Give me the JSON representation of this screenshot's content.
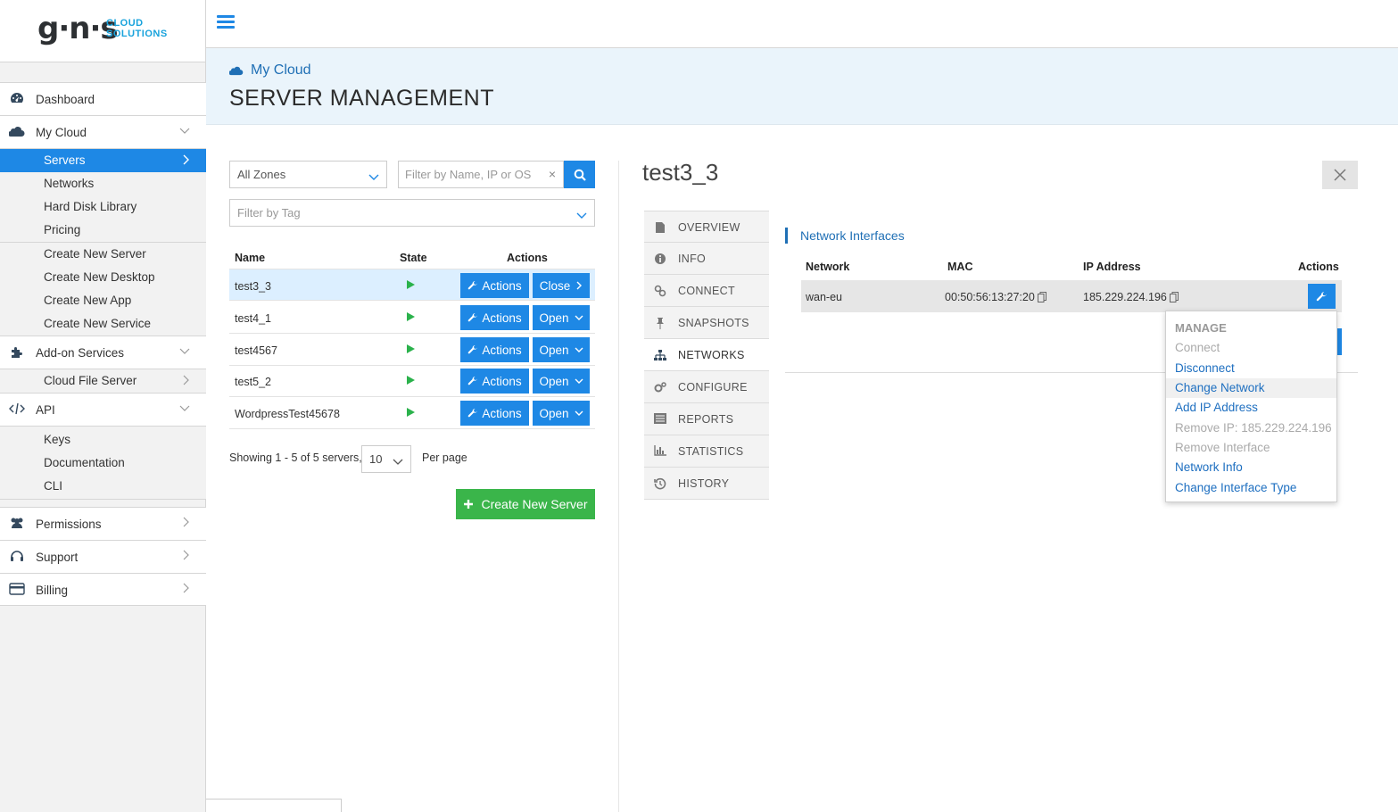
{
  "logo": {
    "main": "g·n·s",
    "sub_line1": "CLOUD",
    "sub_line2": "SOLUTIONS"
  },
  "sidebar": {
    "dashboard": "Dashboard",
    "my_cloud": "My Cloud",
    "my_cloud_items": [
      "Servers",
      "Networks",
      "Hard Disk Library",
      "Pricing"
    ],
    "create_items": [
      "Create New Server",
      "Create New Desktop",
      "Create New App",
      "Create New Service"
    ],
    "addon": "Add-on Services",
    "addon_items": [
      "Cloud File Server"
    ],
    "api": "API",
    "api_items": [
      "Keys",
      "Documentation",
      "CLI"
    ],
    "permissions": "Permissions",
    "support": "Support",
    "billing": "Billing"
  },
  "header": {
    "breadcrumb": "My Cloud",
    "title": "SERVER MANAGEMENT"
  },
  "filters": {
    "zone_selected": "All Zones",
    "search_placeholder": "Filter by Name, IP or OS",
    "clear": "×",
    "tag_placeholder": "Filter by Tag"
  },
  "table": {
    "headers": {
      "name": "Name",
      "state": "State",
      "actions": "Actions"
    },
    "rows": [
      {
        "name": "test3_3",
        "action": "Actions",
        "toggle": "Close"
      },
      {
        "name": "test4_1",
        "action": "Actions",
        "toggle": "Open"
      },
      {
        "name": "test4567",
        "action": "Actions",
        "toggle": "Open"
      },
      {
        "name": "test5_2",
        "action": "Actions",
        "toggle": "Open"
      },
      {
        "name": "WordpressTest45678",
        "action": "Actions",
        "toggle": "Open"
      }
    ],
    "showing": "Showing 1 - 5 of 5 servers,",
    "per_page_value": "10",
    "per_page_label": "Per page",
    "create_button": "Create New Server"
  },
  "detail": {
    "server_name": "test3_3",
    "tabs": [
      "OVERVIEW",
      "INFO",
      "CONNECT",
      "SNAPSHOTS",
      "NETWORKS",
      "CONFIGURE",
      "REPORTS",
      "STATISTICS",
      "HISTORY"
    ],
    "active_tab": "NETWORKS",
    "section_title": "Network Interfaces",
    "columns": {
      "network": "Network",
      "mac": "MAC",
      "ip": "IP Address",
      "actions": "Actions"
    },
    "interface": {
      "network": "wan-eu",
      "mac": "00:50:56:13:27:20",
      "ip": "185.229.224.196"
    }
  },
  "dropdown": {
    "header": "MANAGE",
    "items": [
      {
        "label": "Connect",
        "enabled": false
      },
      {
        "label": "Disconnect",
        "enabled": true
      },
      {
        "label": "Change Network",
        "enabled": true
      },
      {
        "label": "Add IP Address",
        "enabled": true
      },
      {
        "label": "Remove IP: 185.229.224.196",
        "enabled": false
      },
      {
        "label": "Remove Interface",
        "enabled": false
      },
      {
        "label": "Network Info",
        "enabled": true
      },
      {
        "label": "Change Interface Type",
        "enabled": true
      }
    ]
  },
  "colors": {
    "primary": "#1e88e5",
    "success": "#3ab54a",
    "header_bg": "#eaf4fb",
    "link": "#1e6fc0"
  }
}
